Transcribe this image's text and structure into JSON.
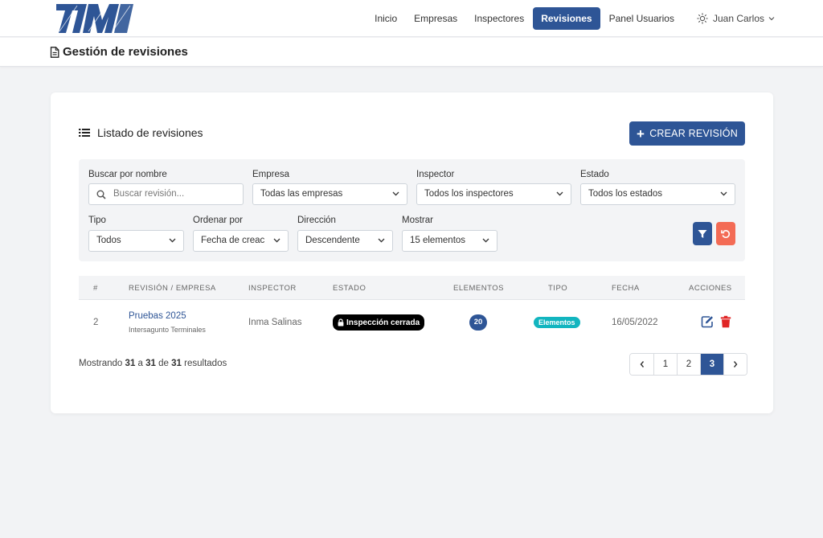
{
  "nav": {
    "links": [
      "Inicio",
      "Empresas",
      "Inspectores",
      "Revisiones",
      "Panel Usuarios"
    ],
    "active": "Revisiones",
    "user": "Juan Carlos"
  },
  "page": {
    "title": "Gestión de revisiones"
  },
  "card": {
    "title": "Listado de revisiones",
    "create_label": "CREAR REVISIÓN"
  },
  "filters": {
    "search_label": "Buscar por nombre",
    "search_placeholder": "Buscar revisión...",
    "empresa_label": "Empresa",
    "empresa_value": "Todas las empresas",
    "inspector_label": "Inspector",
    "inspector_value": "Todos los inspectores",
    "estado_label": "Estado",
    "estado_value": "Todos los estados",
    "tipo_label": "Tipo",
    "tipo_value": "Todos",
    "orden_label": "Ordenar por",
    "orden_value": "Fecha de creac",
    "direccion_label": "Dirección",
    "direccion_value": "Descendente",
    "mostrar_label": "Mostrar",
    "mostrar_value": "15 elementos"
  },
  "table": {
    "headers": [
      "#",
      "Revisión / Empresa",
      "Inspector",
      "Estado",
      "Elementos",
      "Tipo",
      "Fecha",
      "Acciones"
    ],
    "rows": [
      {
        "num": "2",
        "name": "Pruebas 2025",
        "company": "Intersagunto Terminales",
        "inspector": "Inma Salinas",
        "estado": "Inspección cerrada",
        "elementos": "20",
        "tipo": "Elementos",
        "fecha": "16/05/2022"
      }
    ]
  },
  "results": {
    "prefix": "Mostrando",
    "from": "31",
    "a": "a",
    "to": "31",
    "de": "de",
    "total": "31",
    "suffix": "resultados"
  },
  "pagination": {
    "pages": [
      "1",
      "2",
      "3"
    ],
    "active": "3"
  },
  "colors": {
    "primary": "#2e5596",
    "danger": "#e02424",
    "reset": "#f36b55",
    "teal": "#12b5bf"
  }
}
